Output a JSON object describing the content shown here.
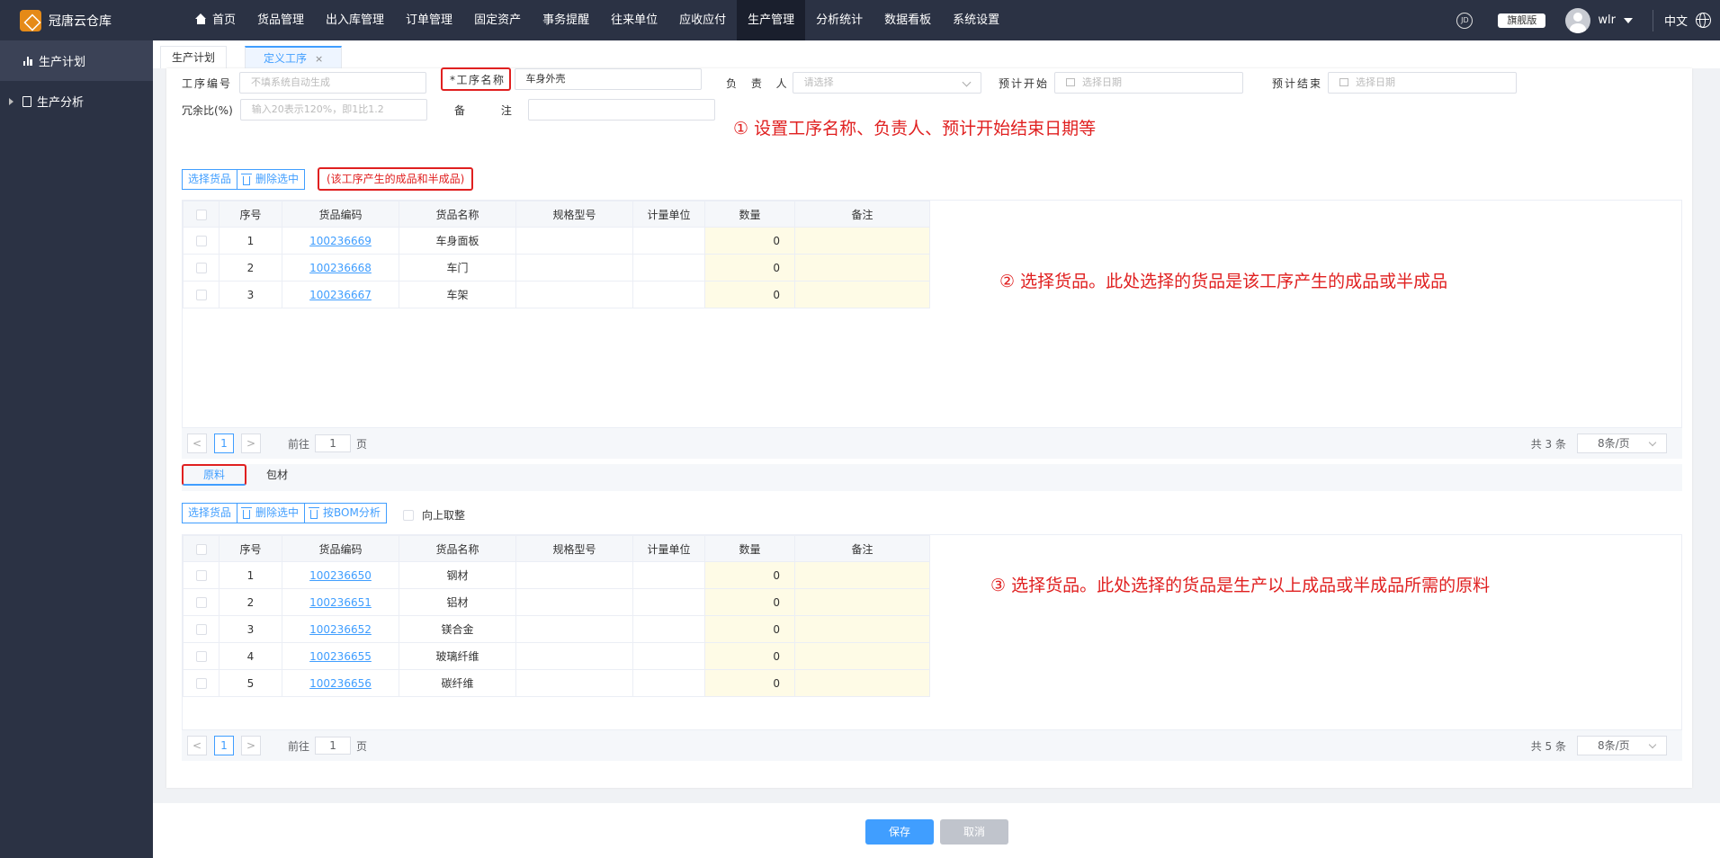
{
  "app": {
    "title": "冠唐云仓库"
  },
  "nav": {
    "home": "首页",
    "items": [
      "货品管理",
      "出入库管理",
      "订单管理",
      "固定资产",
      "事务提醒",
      "往来单位",
      "应收应付",
      "生产管理",
      "分析统计",
      "数据看板",
      "系统设置"
    ],
    "active": "生产管理"
  },
  "header": {
    "edition": "旗舰版",
    "user": "wlr",
    "lang": "中文",
    "icon_text": "JD"
  },
  "sidebar": {
    "items": [
      {
        "label": "生产计划",
        "icon": "bar-chart-icon"
      },
      {
        "label": "生产分析",
        "icon": "document-icon"
      }
    ]
  },
  "tabs": [
    {
      "label": "生产计划"
    },
    {
      "label": "定义工序",
      "close": "×"
    }
  ],
  "form": {
    "code_label": "工序编号",
    "code_placeholder": "不填系统自动生成",
    "name_label": "*工序名称",
    "name_value": "车身外壳",
    "owner_label": "负 责 人",
    "owner_placeholder": "请选择",
    "start_label": "预计开始",
    "start_placeholder": "选择日期",
    "end_label": "预计结束",
    "end_placeholder": "选择日期",
    "redundancy_label": "冗余比(%)",
    "redundancy_placeholder": "输入20表示120%，即1比1.2",
    "remark_label": "备 注",
    "remark_value": ""
  },
  "notes": {
    "n1": "① 设置工序名称、负责人、预计开始结束日期等",
    "n2": "② 选择货品。此处选择的货品是该工序产生的成品或半成品",
    "n3": "③ 选择货品。此处选择的货品是生产以上成品或半成品所需的原料"
  },
  "products": {
    "select_btn": "选择货品",
    "delete_btn": "删除选中",
    "hint": "(该工序产生的成品和半成品)",
    "columns": [
      "序号",
      "货品编码",
      "货品名称",
      "规格型号",
      "计量单位",
      "数量",
      "备注"
    ],
    "rows": [
      {
        "idx": "1",
        "code": "100236669",
        "name": "车身面板",
        "qty": "0"
      },
      {
        "idx": "2",
        "code": "100236668",
        "name": "车门",
        "qty": "0"
      },
      {
        "idx": "3",
        "code": "100236667",
        "name": "车架",
        "qty": "0"
      }
    ],
    "pager": {
      "prev": "<",
      "page": "1",
      "next": ">",
      "goto": "前往",
      "goto_value": "1",
      "page_unit": "页",
      "total": "共 3 条",
      "size": "8条/页"
    }
  },
  "materials": {
    "tabs": [
      "原料",
      "包材"
    ],
    "select_btn": "选择货品",
    "delete_btn": "删除选中",
    "bom_btn": "按BOM分析",
    "round_label": "向上取整",
    "columns": [
      "序号",
      "货品编码",
      "货品名称",
      "规格型号",
      "计量单位",
      "数量",
      "备注"
    ],
    "rows": [
      {
        "idx": "1",
        "code": "100236650",
        "name": "钢材",
        "qty": "0"
      },
      {
        "idx": "2",
        "code": "100236651",
        "name": "铝材",
        "qty": "0"
      },
      {
        "idx": "3",
        "code": "100236652",
        "name": "镁合金",
        "qty": "0"
      },
      {
        "idx": "4",
        "code": "100236655",
        "name": "玻璃纤维",
        "qty": "0"
      },
      {
        "idx": "5",
        "code": "100236656",
        "name": "碳纤维",
        "qty": "0"
      }
    ],
    "pager": {
      "prev": "<",
      "page": "1",
      "next": ">",
      "goto": "前往",
      "goto_value": "1",
      "page_unit": "页",
      "total": "共 5 条",
      "size": "8条/页"
    }
  },
  "footer": {
    "save": "保存",
    "cancel": "取消"
  },
  "colors": {
    "accent": "#409eff",
    "annotation": "#e02020",
    "nav_bg": "#2b3244"
  }
}
